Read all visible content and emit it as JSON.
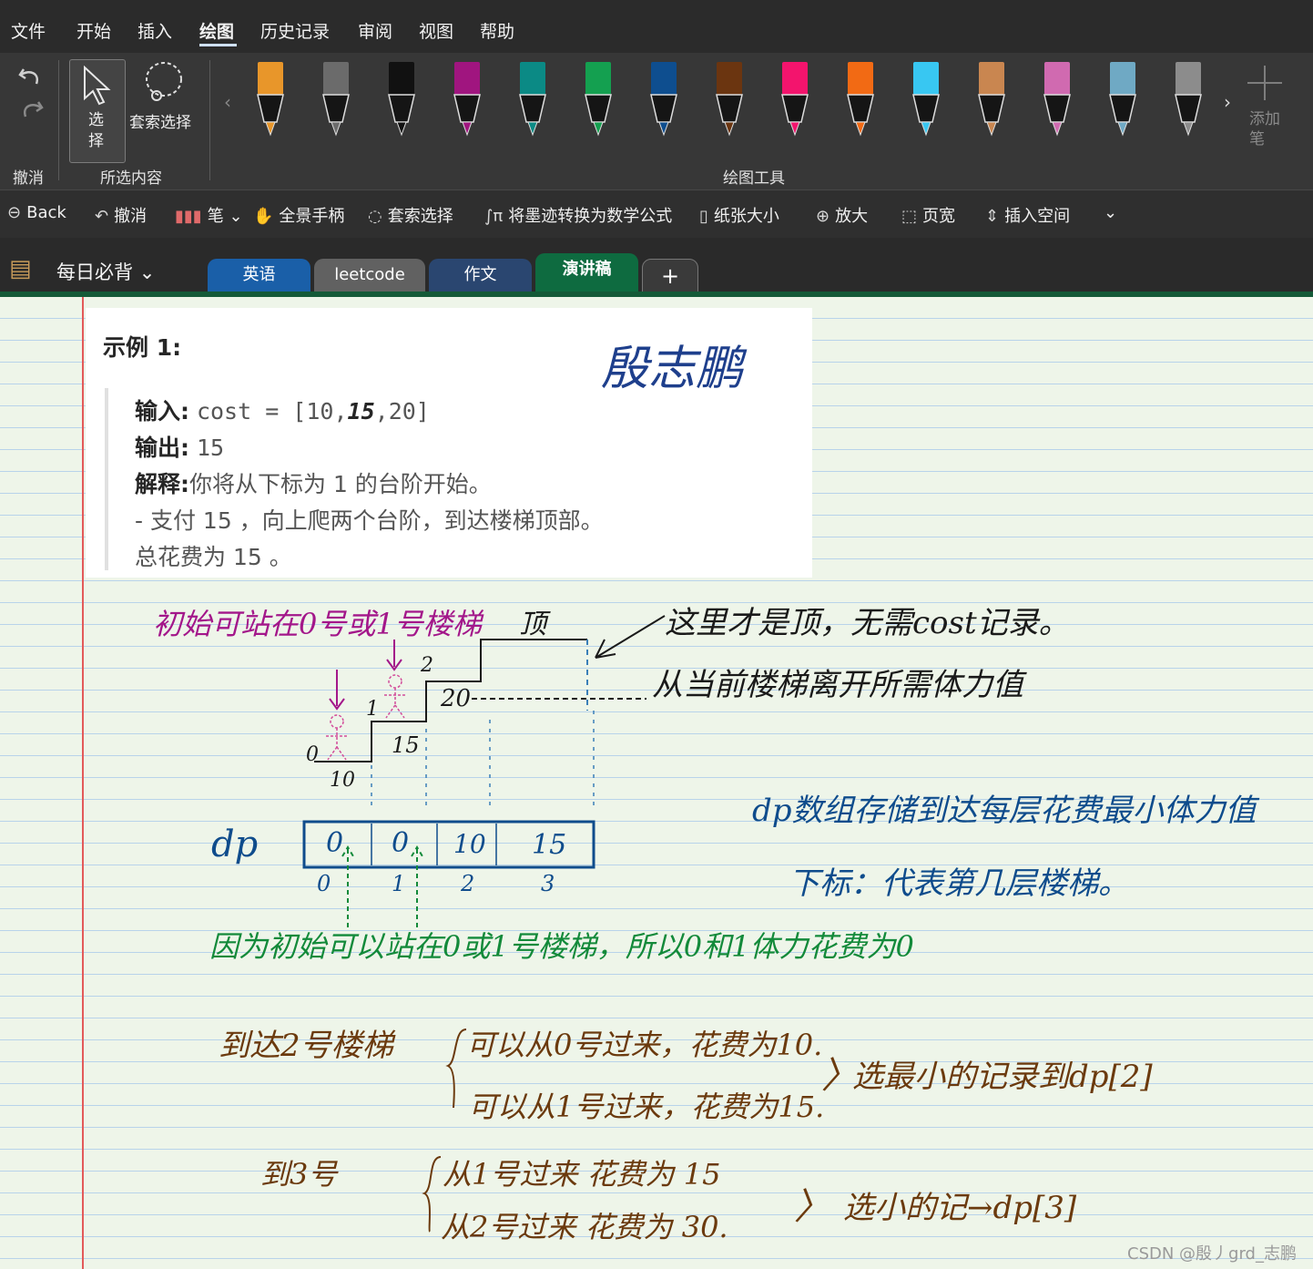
{
  "menu": {
    "items": [
      "文件",
      "开始",
      "插入",
      "绘图",
      "历史记录",
      "审阅",
      "视图",
      "帮助"
    ]
  },
  "ribbon": {
    "select_label": "选择",
    "lasso_label": "套索选择",
    "undo_group": "撤消",
    "selection_group": "所选内容",
    "drawing_tools_group": "绘图工具",
    "add_pen_label": "添加笔",
    "pens": [
      {
        "name": "highlighter-orange",
        "color": "#e8962a"
      },
      {
        "name": "pen-gray-a",
        "color": "#6b6b6b"
      },
      {
        "name": "pen-black",
        "color": "#111111"
      },
      {
        "name": "pen-purple",
        "color": "#a0157f"
      },
      {
        "name": "pen-teal",
        "color": "#0b8a85"
      },
      {
        "name": "pen-green",
        "color": "#14a050"
      },
      {
        "name": "pen-blue",
        "color": "#0e4e8f"
      },
      {
        "name": "pen-brown",
        "color": "#6b3510"
      },
      {
        "name": "pen-pink",
        "color": "#f3146d"
      },
      {
        "name": "pen-orange",
        "color": "#f26a14"
      },
      {
        "name": "pen-cyan",
        "color": "#38c7f2"
      },
      {
        "name": "pen-wood",
        "color": "#c98650"
      },
      {
        "name": "pen-rainbow",
        "color": "#d06ab0"
      },
      {
        "name": "pen-galaxy",
        "color": "#6fa9c4"
      },
      {
        "name": "pen-gray",
        "color": "#8c8c8c"
      }
    ]
  },
  "toolbar": {
    "back": "Back",
    "undo": "撤消",
    "pen": "笔",
    "pan": "全景手柄",
    "lasso": "套索选择",
    "ink_to_math": "将墨迹转换为数学公式",
    "paper_size": "纸张大小",
    "zoom_in": "放大",
    "page_width": "页宽",
    "insert_space": "插入空间"
  },
  "notebook": {
    "name": "每日必背"
  },
  "tabs": [
    {
      "label": "英语",
      "color": "#1a5fa8"
    },
    {
      "label": "leetcode",
      "color": "#616161"
    },
    {
      "label": "作文",
      "color": "#2a4670"
    },
    {
      "label": "演讲稿",
      "color": "#0e6b40"
    },
    {
      "label": "+",
      "color": "#3a3a3a"
    }
  ],
  "example": {
    "title": "示例 1:",
    "input_label": "输入:",
    "input_value_pre": "cost = [10,",
    "input_value_bold": "15",
    "input_value_post": ",20]",
    "output_label": "输出:",
    "output_value": "15",
    "explain_label": "解释:",
    "explain_value": "你将从下标为 1 的台阶开始。",
    "line4": "- 支付 15 ，向上爬两个台阶，到达楼梯顶部。",
    "line5": "总花费为 15 。"
  },
  "handwriting": {
    "signature": "殷志鹏",
    "start_note": "初始可站在0号或1号楼梯",
    "top_label": "顶",
    "top_note": "这里才是顶，无需cost记录。",
    "leave_note": "从当前楼梯离开所需体力值",
    "stair_costs": [
      "10",
      "15",
      "20"
    ],
    "stair_indices": [
      "0",
      "1",
      "2"
    ],
    "dp_label": "dp",
    "dp_values": [
      "0",
      "0",
      "10",
      "15"
    ],
    "dp_indices": [
      "0",
      "1",
      "2",
      "3"
    ],
    "dp_def": "dp数组存储到达每层花费最小体力值",
    "index_def": "下标：代表第几层楼梯。",
    "because_note": "因为初始可以站在0或1号楼梯，所以0和1体力花费为0",
    "to2": "到达2号楼梯",
    "to2_a": "可以从0号过来，花费为10.",
    "to2_b": "可以从1号过来，花费为15.",
    "to2_pick": "选最小的记录到dp[2]",
    "to3": "到3号",
    "to3_a": "从1号过来  花费为  15",
    "to3_b": "从2号过来  花费为  30.",
    "to3_pick": "选小的记→dp[3]"
  },
  "colors": {
    "purple_ink": "#a3178a",
    "blue_ink": "#0f4c8c",
    "green_ink": "#138a3a",
    "brown_ink": "#6b3a0e",
    "black_ink": "#1a1a1a"
  },
  "watermark": "CSDN @殷丿grd_志鹏"
}
